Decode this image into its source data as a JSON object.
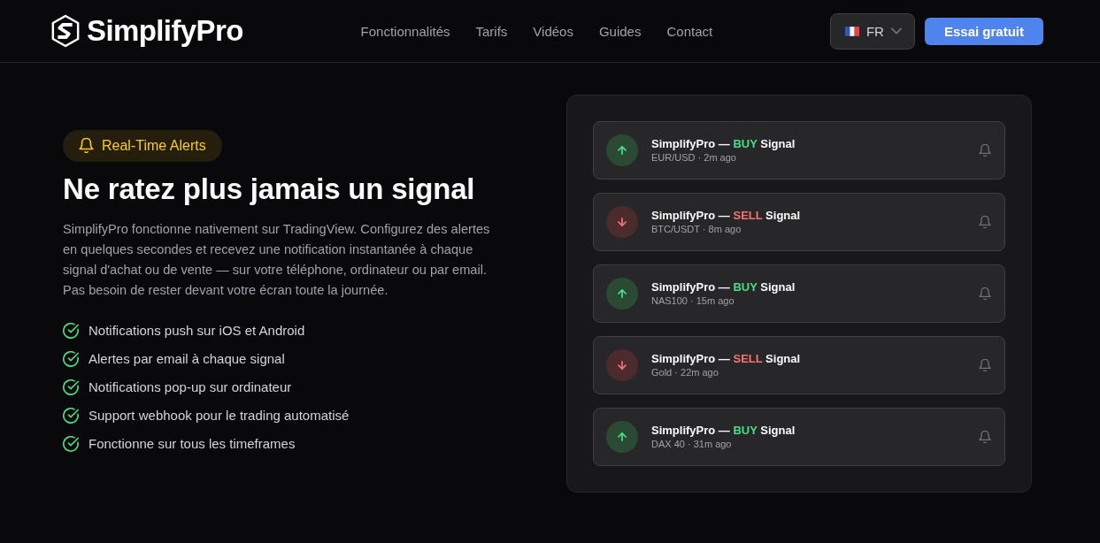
{
  "header": {
    "logo": "SimplifyPro",
    "nav": [
      "Fonctionnalités",
      "Tarifs",
      "Vidéos",
      "Guides",
      "Contact"
    ],
    "language": "FR",
    "cta": "Essai gratuit"
  },
  "hero": {
    "badge": "Real-Time Alerts",
    "title": "Ne ratez plus jamais un signal",
    "description": "SimplifyPro fonctionne nativement sur TradingView. Configurez des alertes en quelques secondes et recevez une notification instantanée à chaque signal d'achat ou de vente — sur votre téléphone, ordinateur ou par email. Pas besoin de rester devant votre écran toute la journée.",
    "features": [
      "Notifications push sur iOS et Android",
      "Alertes par email à chaque signal",
      "Notifications pop-up sur ordinateur",
      "Support webhook pour le trading automatisé",
      "Fonctionne sur tous les timeframes"
    ]
  },
  "alerts": [
    {
      "kind": "buy",
      "source": "SimplifyPro —",
      "action": "BUY",
      "label": "Signal",
      "meta": "EUR/USD · 2m ago"
    },
    {
      "kind": "sell",
      "source": "SimplifyPro —",
      "action": "SELL",
      "label": "Signal",
      "meta": "BTC/USDT · 8m ago"
    },
    {
      "kind": "buy",
      "source": "SimplifyPro —",
      "action": "BUY",
      "label": "Signal",
      "meta": "NAS100 · 15m ago"
    },
    {
      "kind": "sell",
      "source": "SimplifyPro —",
      "action": "SELL",
      "label": "Signal",
      "meta": "Gold · 22m ago"
    },
    {
      "kind": "buy",
      "source": "SimplifyPro —",
      "action": "BUY",
      "label": "Signal",
      "meta": "DAX 40 · 31m ago"
    }
  ]
}
